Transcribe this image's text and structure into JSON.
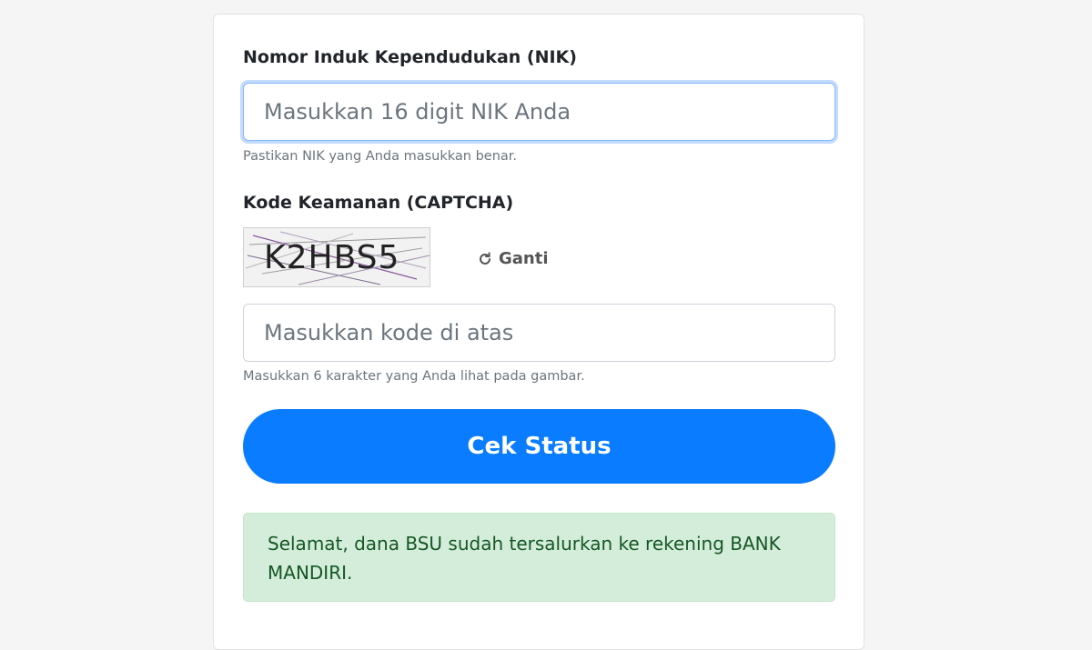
{
  "form": {
    "nik": {
      "label": "Nomor Induk Kependudukan (NIK)",
      "value": "",
      "placeholder": "Masukkan 16 digit NIK Anda",
      "help": "Pastikan NIK yang Anda masukkan benar."
    },
    "captcha": {
      "label": "Kode Keamanan (CAPTCHA)",
      "code": "K2HBS5",
      "refresh_label": "Ganti",
      "refresh_icon": "refresh-icon",
      "value": "",
      "placeholder": "Masukkan kode di atas",
      "help": "Masukkan 6 karakter yang Anda lihat pada gambar."
    },
    "submit_label": "Cek Status"
  },
  "result": {
    "message": "Selamat, dana BSU sudah tersalurkan ke rekening BANK MANDIRI."
  },
  "colors": {
    "primary": "#0a7cff",
    "success_bg": "#d4edda",
    "success_text": "#155724",
    "focus_border": "#86b7fe"
  }
}
